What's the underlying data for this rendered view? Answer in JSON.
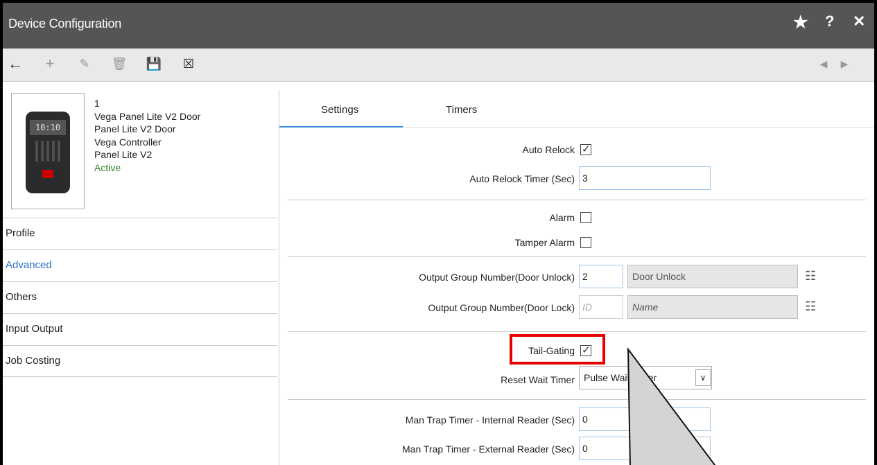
{
  "window": {
    "title": "Device Configuration"
  },
  "title_controls": {
    "star": "★",
    "help": "?",
    "close": "✕"
  },
  "toolbar": {
    "back": "←",
    "add": "+",
    "edit": "✎",
    "delete": "🗑",
    "save": "💾",
    "clear": "☒",
    "prev": "◀",
    "next": "▶"
  },
  "device": {
    "screen_text": "10:10",
    "id": "1",
    "name": "Vega Panel Lite V2 Door",
    "type": "Panel Lite V2 Door",
    "controller": "Vega Controller",
    "model": "Panel Lite V2",
    "status": "Active"
  },
  "nav": {
    "items": [
      {
        "label": "Profile"
      },
      {
        "label": "Advanced"
      },
      {
        "label": "Others"
      },
      {
        "label": "Input Output"
      },
      {
        "label": "Job Costing"
      }
    ],
    "selected": "Advanced"
  },
  "tabs": [
    {
      "label": "Settings"
    },
    {
      "label": "Timers"
    }
  ],
  "form": {
    "auto_relock": {
      "label": "Auto Relock",
      "checked": true
    },
    "auto_relock_timer": {
      "label": "Auto Relock Timer (Sec)",
      "value": "3"
    },
    "alarm": {
      "label": "Alarm",
      "checked": false
    },
    "tamper_alarm": {
      "label": "Tamper Alarm",
      "checked": false
    },
    "output_unlock": {
      "label": "Output Group Number(Door Unlock)",
      "id": "2",
      "name": "Door Unlock"
    },
    "output_lock": {
      "label": "Output Group Number(Door Lock)",
      "id_placeholder": "ID",
      "name_placeholder": "Name"
    },
    "tail_gating": {
      "label": "Tail-Gating",
      "checked": true
    },
    "reset_wait_timer": {
      "label": "Reset Wait Timer",
      "value": "Pulse Wait Timer"
    },
    "man_trap_internal": {
      "label": "Man Trap Timer - Internal Reader (Sec)",
      "value": "0"
    },
    "man_trap_external": {
      "label": "Man Trap Timer - External Reader (Sec)",
      "value": "0"
    }
  },
  "colors": {
    "highlight": "#e60000",
    "accent": "#3a8bd8",
    "active": "#2a8a2a"
  }
}
